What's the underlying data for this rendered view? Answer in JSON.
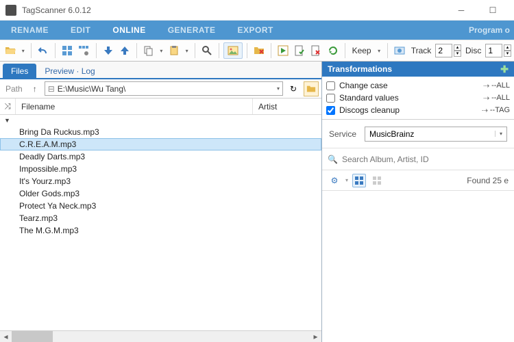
{
  "title": "TagScanner 6.0.12",
  "menu": {
    "items": [
      "RENAME",
      "EDIT",
      "ONLINE",
      "GENERATE",
      "EXPORT"
    ],
    "active": 2,
    "rightCut": "Program o"
  },
  "toolbar": {
    "keep": "Keep",
    "track": "Track",
    "trackVal": "2",
    "disc": "Disc",
    "discVal": "1"
  },
  "leftTabs": {
    "files": "Files",
    "preview": "Preview · Log"
  },
  "pathbar": {
    "label": "Path",
    "value": "E:\\Music\\Wu Tang\\"
  },
  "columns": {
    "filename": "Filename",
    "artist": "Artist"
  },
  "files": [
    {
      "name": "Bring Da Ruckus.mp3",
      "selected": false
    },
    {
      "name": "C.R.E.A.M.mp3",
      "selected": true
    },
    {
      "name": "Deadly Darts.mp3",
      "selected": false
    },
    {
      "name": "Impossible.mp3",
      "selected": false
    },
    {
      "name": "It's Yourz.mp3",
      "selected": false
    },
    {
      "name": "Older Gods.mp3",
      "selected": false
    },
    {
      "name": "Protect Ya Neck.mp3",
      "selected": false
    },
    {
      "name": "Tearz.mp3",
      "selected": false
    },
    {
      "name": "The M.G.M.mp3",
      "selected": false
    }
  ],
  "right": {
    "header": "Transformations",
    "transforms": [
      {
        "label": "Change case",
        "checked": false,
        "target": "--ALL"
      },
      {
        "label": "Standard values",
        "checked": false,
        "target": "--ALL"
      },
      {
        "label": "Discogs cleanup",
        "checked": true,
        "target": "--TAG"
      }
    ],
    "serviceLabel": "Service",
    "serviceValue": "MusicBrainz",
    "searchPlaceholder": "Search Album, Artist, ID",
    "found": "Found 25 e"
  }
}
